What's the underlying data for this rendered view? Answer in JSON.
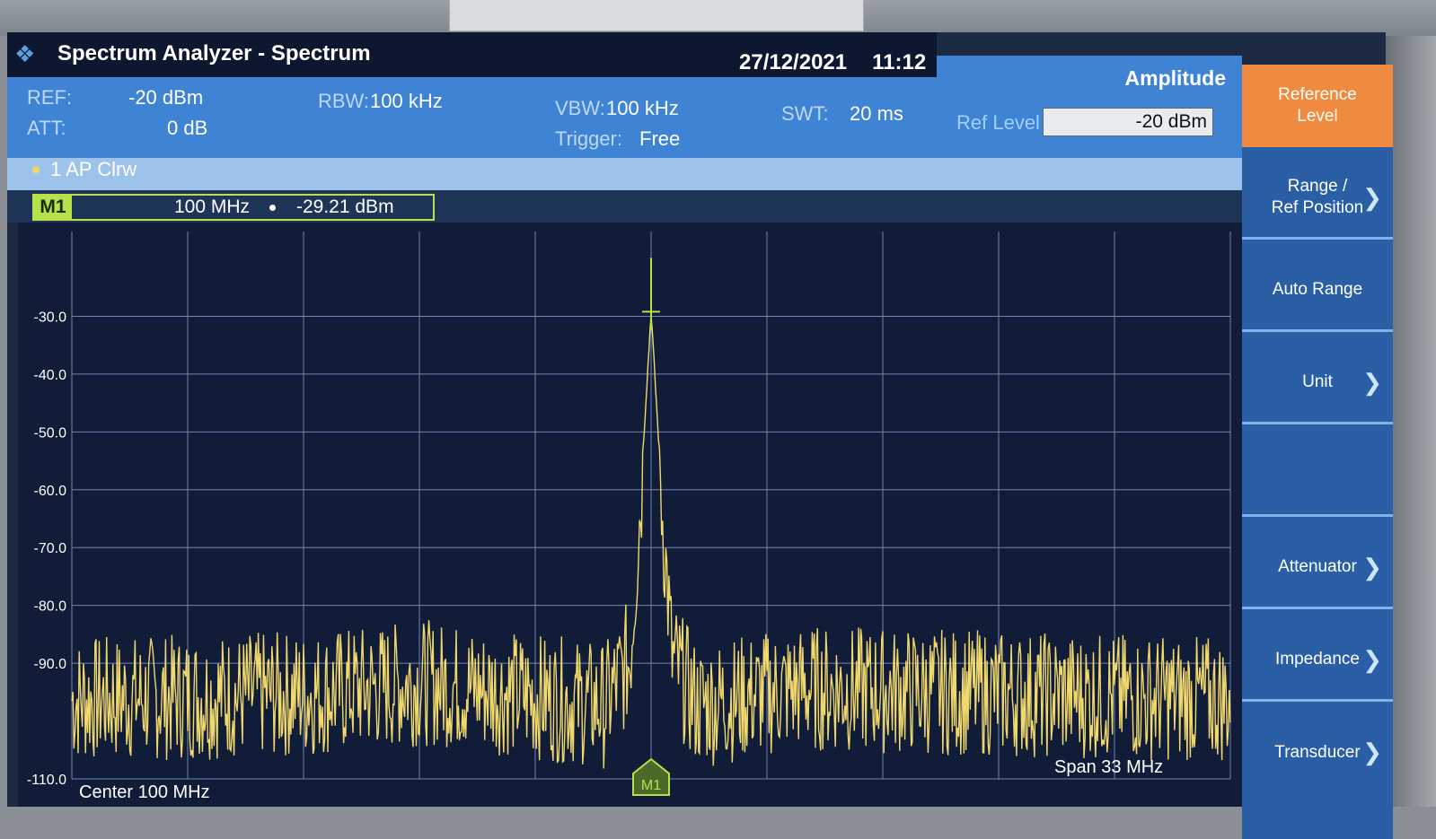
{
  "window": {
    "title": "Spectrum Analyzer - Spectrum",
    "date": "27/12/2021",
    "time": "11:12"
  },
  "settings": {
    "ref_label": "REF:",
    "ref_value": "-20 dBm",
    "att_label": "ATT:",
    "att_value": "0 dB",
    "rbw_label": "RBW:",
    "rbw_value": "100 kHz",
    "vbw_label": "VBW:",
    "vbw_value": "100 kHz",
    "trigger_label": "Trigger:",
    "trigger_value": "Free",
    "swt_label": "SWT:",
    "swt_value": "20 ms"
  },
  "trace": {
    "label": "1 AP  Clrw",
    "color": "#f1d86c"
  },
  "marker": {
    "tag": "M1",
    "frequency": "100 MHz",
    "level": "-29.21 dBm",
    "color": "#b7e14a"
  },
  "amplitude_panel": {
    "title": "Amplitude",
    "ref_level_label": "Ref Level",
    "ref_level_value": "-20 dBm"
  },
  "softkeys": [
    {
      "label": "Reference\nLevel",
      "active": true,
      "submenu": false
    },
    {
      "label": "Range /\nRef Position",
      "active": false,
      "submenu": true
    },
    {
      "label": "Auto Range",
      "active": false,
      "submenu": false
    },
    {
      "label": "Unit",
      "active": false,
      "submenu": true
    },
    {
      "label": "",
      "active": false,
      "submenu": false
    },
    {
      "label": "Attenuator",
      "active": false,
      "submenu": true
    },
    {
      "label": "Impedance",
      "active": false,
      "submenu": true
    },
    {
      "label": "Transducer",
      "active": false,
      "submenu": true
    }
  ],
  "chart_data": {
    "type": "line",
    "xlabel": "Center 100 MHz",
    "x_span_label": "Span 33 MHz",
    "center_mhz": 100,
    "span_mhz": 33,
    "ylim": [
      -110,
      -20
    ],
    "y_ticks": [
      "-30.0",
      "-40.0",
      "-50.0",
      "-60.0",
      "-70.0",
      "-80.0",
      "-90.0",
      "-110.0"
    ],
    "series": [
      {
        "x_mhz": [
          83.5,
          90.3,
          93.5,
          98.7,
          99.4,
          99.8,
          100.0,
          100.2,
          100.6,
          101.3,
          104.2,
          116.5
        ],
        "level_dbm": [
          -93,
          -92,
          -90,
          -94,
          -86,
          -50,
          -29.21,
          -50,
          -86,
          -94,
          -91,
          -93
        ]
      }
    ],
    "marker": {
      "x_mhz": 100,
      "level_dbm": -29.21
    },
    "grid": true
  }
}
